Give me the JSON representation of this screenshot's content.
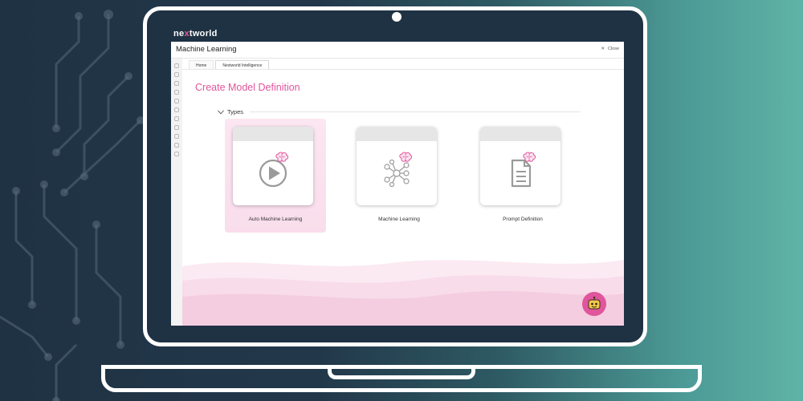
{
  "brand": {
    "prefix": "ne",
    "o": "x",
    "suffix": "tworld"
  },
  "window": {
    "title": "Machine Learning",
    "close_label": "Close"
  },
  "tabs": [
    {
      "label": "Home",
      "active": false
    },
    {
      "label": "Nextworld Intelligence",
      "active": true
    }
  ],
  "page": {
    "title": "Create Model Definition",
    "section_label": "Types"
  },
  "types": [
    {
      "label": "Auto Machine Learning",
      "icon": "play-circle-icon",
      "selected": true
    },
    {
      "label": "Machine Learning",
      "icon": "neural-network-icon",
      "selected": false
    },
    {
      "label": "Prompt Definition",
      "icon": "document-icon",
      "selected": false
    }
  ],
  "colors": {
    "accent": "#e0559c",
    "background_dark": "#1f3244",
    "background_teal": "#5fb3a6"
  }
}
